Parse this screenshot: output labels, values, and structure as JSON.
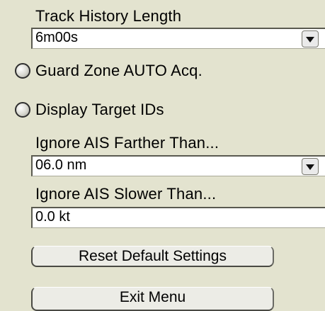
{
  "settings": {
    "track_history": {
      "label": "Track History Length",
      "value": "6m00s",
      "dropdown_icon": "chevron-down-icon"
    },
    "guard_zone": {
      "label": "Guard Zone AUTO Acq.",
      "checked": false
    },
    "display_target_ids": {
      "label": "Display Target IDs",
      "checked": false
    },
    "ignore_farther": {
      "label": "Ignore AIS Farther Than...",
      "value": "06.0 nm",
      "dropdown_icon": "chevron-down-icon"
    },
    "ignore_slower": {
      "label": "Ignore AIS Slower Than...",
      "value": "0.0 kt"
    }
  },
  "buttons": {
    "reset_label": "Reset Default Settings",
    "exit_label": "Exit Menu"
  },
  "colors": {
    "panel_bg": "#e3e3cf",
    "field_bg": "#ffffff",
    "button_bg": "#ecece6"
  }
}
